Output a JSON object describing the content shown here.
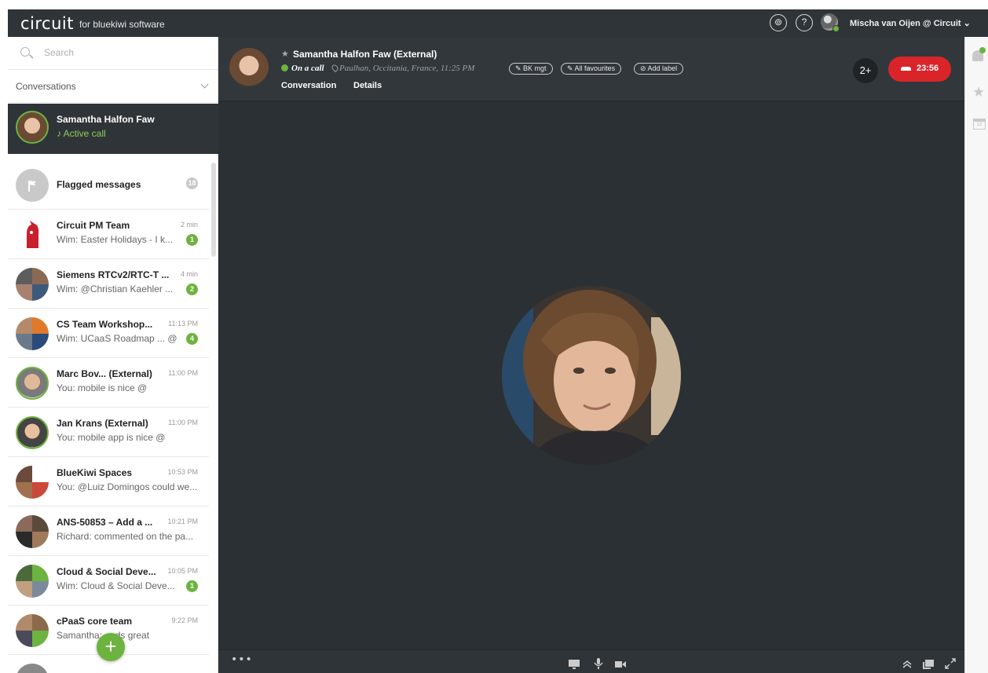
{
  "topbar": {
    "logo": "circuit",
    "logo_sub": "for bluekiwi software",
    "user_name": "Mischa van Oijen @ Circuit ⌄",
    "icon_names": [
      "voicemail-icon",
      "help-icon",
      "user-avatar"
    ]
  },
  "sidebar": {
    "search_placeholder": "Search",
    "conversations_label": "Conversations",
    "active_call": {
      "name": "Samantha Halfon Faw",
      "status": "♪ Active call"
    },
    "items": [
      {
        "title": "Flagged messages",
        "preview": "",
        "time": "",
        "badge": "18"
      },
      {
        "title": "Circuit PM Team",
        "preview": "Wim: Easter Holidays - I k...",
        "time": "2 min",
        "badge": "1"
      },
      {
        "title": "Siemens RTCv2/RTC-T ...",
        "preview": "Wim: @Christian Kaehler ...",
        "time": "4 min",
        "badge": "2"
      },
      {
        "title": "CS Team Workshop...",
        "preview": "Wim: UCaaS Roadmap ... @",
        "time": "11:13 PM",
        "badge": "4"
      },
      {
        "title": "Marc Bov... (External)",
        "preview": "You: mobile is nice @",
        "time": "11:00 PM",
        "badge": ""
      },
      {
        "title": "Jan Krans (External)",
        "preview": "You: mobile app is nice @",
        "time": "11:00 PM",
        "badge": ""
      },
      {
        "title": "BlueKiwi Spaces",
        "preview": "You: @Luiz Domingos could we...",
        "time": "10:53 PM",
        "badge": ""
      },
      {
        "title": "ANS-50853 – Add a ...",
        "preview": "Richard: commented on the pa...",
        "time": "10:21 PM",
        "badge": ""
      },
      {
        "title": "Cloud & Social Deve...",
        "preview": "Wim: Cloud & Social Deve...",
        "time": "10:05 PM",
        "badge": "1"
      },
      {
        "title": "cPaaS core team",
        "preview": "Samantha: ... ds great",
        "time": "9:22 PM",
        "badge": ""
      }
    ],
    "fab_label": "+"
  },
  "header": {
    "name": "Samantha Halfon Faw (External)",
    "status": "On a call",
    "location": "Paulhan, Occitania, France, 11:25 PM",
    "labels": [
      "BK mgt",
      "All favourites",
      "Add label"
    ],
    "tabs": [
      "Conversation",
      "Details"
    ],
    "add_user_label": "2+",
    "call_timer": "23:56"
  },
  "bottombar": {
    "more_label": "•••"
  },
  "rail": {
    "calendar_label": "12"
  },
  "colors": {
    "accent": "#6db33f",
    "hangup": "#d9252a",
    "dark": "#2f3438"
  }
}
